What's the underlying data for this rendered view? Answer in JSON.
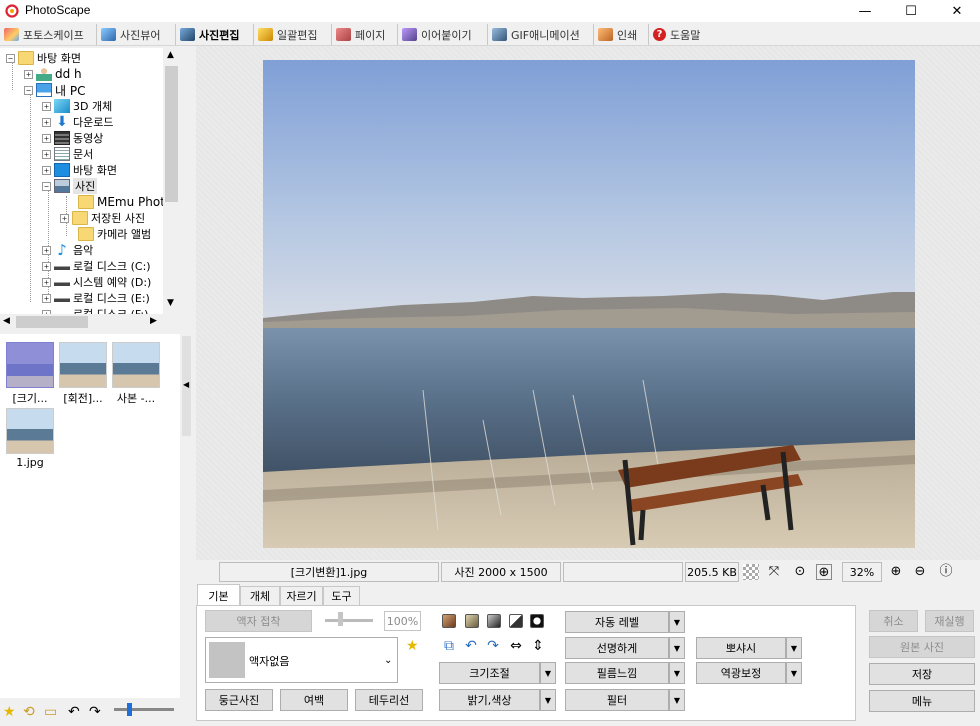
{
  "window": {
    "title": "PhotoScape",
    "minimize": "—",
    "maximize": "☐",
    "close": "✕"
  },
  "tabs": [
    {
      "label": "포토스케이프",
      "color": "#d8504a"
    },
    {
      "label": "사진뷰어",
      "color": "#3a7bd5"
    },
    {
      "label": "사진편집",
      "color": "#2f6fbf",
      "active": true
    },
    {
      "label": "일괄편집",
      "color": "#e0a030"
    },
    {
      "label": "페이지",
      "color": "#c05050"
    },
    {
      "label": "이어붙이기",
      "color": "#6a5acd"
    },
    {
      "label": "GIF애니메이션",
      "color": "#4a6ea8"
    },
    {
      "label": "인쇄",
      "color": "#d47a2a"
    },
    {
      "label": "도움말",
      "color": "#d42020"
    }
  ],
  "tree": {
    "desktop_root": "바탕 화면",
    "user": "dd h",
    "pc": "내 PC",
    "items": [
      "3D 개체",
      "다운로드",
      "동영상",
      "문서",
      "바탕 화면",
      "사진"
    ],
    "photo_children": [
      "MEmu Phot",
      "저장된 사진",
      "카메라 앨범"
    ],
    "after": [
      "음악",
      "로컬 디스크 (C:)",
      "시스템 예약 (D:)",
      "로컬 디스크 (E:)",
      "로컬 디스크 (F:)"
    ]
  },
  "thumbnails": [
    {
      "label": "[크기..."
    },
    {
      "label": "[회전]..."
    },
    {
      "label": "사본 -..."
    },
    {
      "label": "1.jpg"
    }
  ],
  "infobar": {
    "filename": "[크기변환]1.jpg",
    "dimensions": "사진 2000 x 1500",
    "blank": "",
    "filesize": "205.5 KB",
    "zoom": "32%"
  },
  "edit_tabs": [
    "기본",
    "개체",
    "자르기",
    "도구"
  ],
  "basic": {
    "frame_fit": "액자 접착",
    "percent": "100%",
    "frame_name": "액자없음",
    "round_photo": "둥근사진",
    "margin": "여백",
    "border": "테두리선",
    "resize": "크기조절",
    "brightness_color": "밝기,색상",
    "auto_level": "자동 레벨",
    "sharpen": "선명하게",
    "film_effect": "필름느낌",
    "filter": "필터",
    "bloom": "뽀샤시",
    "backlight": "역광보정"
  },
  "right_buttons": {
    "undo": "취소",
    "redo": "재실행",
    "original": "원본 사진",
    "save": "저장",
    "menu": "메뉴"
  },
  "colors": {
    "accent": "#1e6fd9",
    "folder": "#f8d775",
    "star": "#e5b800"
  }
}
